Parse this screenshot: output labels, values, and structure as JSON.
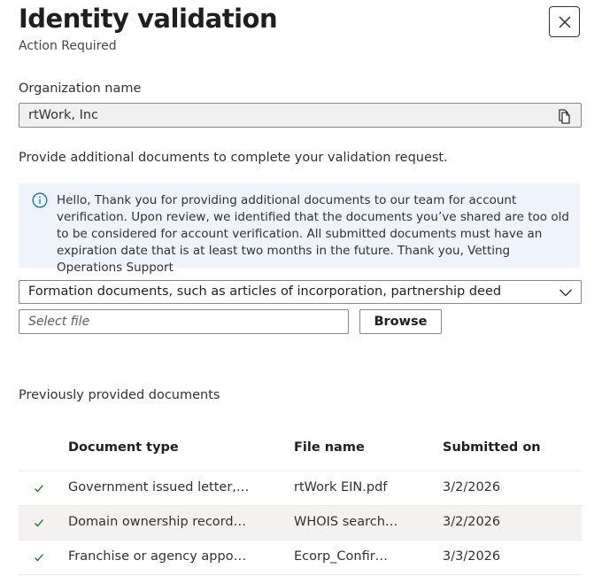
{
  "header": {
    "title": "Identity validation",
    "subtitle": "Action Required"
  },
  "organization": {
    "label": "Organization name",
    "value": "rtWork, Inc"
  },
  "instructions": "Provide additional documents to complete your validation request.",
  "info_message": "Hello,  Thank you for providing additional documents to our team for account verification. Upon review, we identified that the documents you’ve shared are too old to be considered for account verification.  All submitted documents must have an expiration date that is at least two months in the future.   Thank you,  Vetting Operations Support",
  "document_type_select": {
    "selected": "Formation documents, such as articles of incorporation, partnership deed"
  },
  "file_picker": {
    "placeholder": "Select file",
    "browse_label": "Browse"
  },
  "previous": {
    "title": "Previously provided documents",
    "columns": [
      "Document type",
      "File name",
      "Submitted on"
    ],
    "rows": [
      {
        "type": "Government issued letter, lic...",
        "file": "rtWork EIN.pdf",
        "date": "3/2/2026"
      },
      {
        "type": "Domain ownership records, ...",
        "file": "WHOIS search r...",
        "date": "3/2/2026"
      },
      {
        "type": "Franchise or agency appoint...",
        "file": "Ecorp_Confirma...",
        "date": "3/3/2026"
      }
    ]
  },
  "colors": {
    "info_background": "#eff4fc",
    "info_icon": "#0f6cbd",
    "check": "#107c10"
  }
}
